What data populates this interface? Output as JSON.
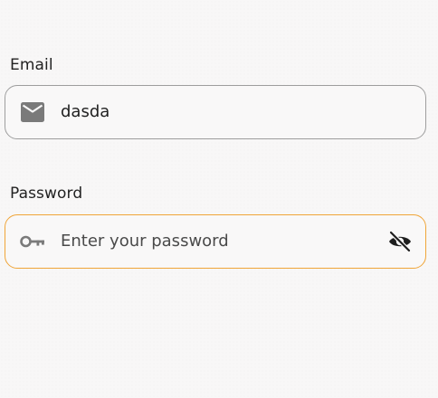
{
  "form": {
    "email": {
      "label": "Email",
      "value": "dasda",
      "icon": "mail-icon"
    },
    "password": {
      "label": "Password",
      "placeholder": "Enter your password",
      "icon": "key-icon",
      "toggle_icon": "visibility-off-icon",
      "focused": true
    }
  },
  "colors": {
    "background": "#f8f7f7",
    "text": "#222222",
    "icon": "#7a7a7a",
    "border_default": "#9e9e9e",
    "border_focused": "#f0a538"
  }
}
